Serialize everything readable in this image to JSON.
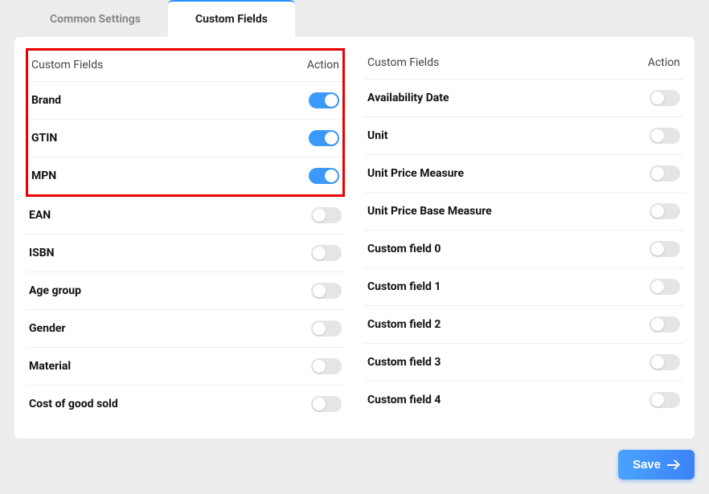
{
  "tabs": {
    "common": "Common Settings",
    "custom": "Custom Fields"
  },
  "headers": {
    "fields": "Custom Fields",
    "action": "Action"
  },
  "left": [
    {
      "label": "Brand",
      "on": true
    },
    {
      "label": "GTIN",
      "on": true
    },
    {
      "label": "MPN",
      "on": true
    },
    {
      "label": "EAN",
      "on": false
    },
    {
      "label": "ISBN",
      "on": false
    },
    {
      "label": "Age group",
      "on": false
    },
    {
      "label": "Gender",
      "on": false
    },
    {
      "label": "Material",
      "on": false
    },
    {
      "label": "Cost of good sold",
      "on": false
    }
  ],
  "right": [
    {
      "label": "Availability Date",
      "on": false
    },
    {
      "label": "Unit",
      "on": false
    },
    {
      "label": "Unit Price Measure",
      "on": false
    },
    {
      "label": "Unit Price Base Measure",
      "on": false
    },
    {
      "label": "Custom field 0",
      "on": false
    },
    {
      "label": "Custom field 1",
      "on": false
    },
    {
      "label": "Custom field 2",
      "on": false
    },
    {
      "label": "Custom field 3",
      "on": false
    },
    {
      "label": "Custom field 4",
      "on": false
    }
  ],
  "buttons": {
    "save": "Save"
  },
  "highlight_count": 3
}
